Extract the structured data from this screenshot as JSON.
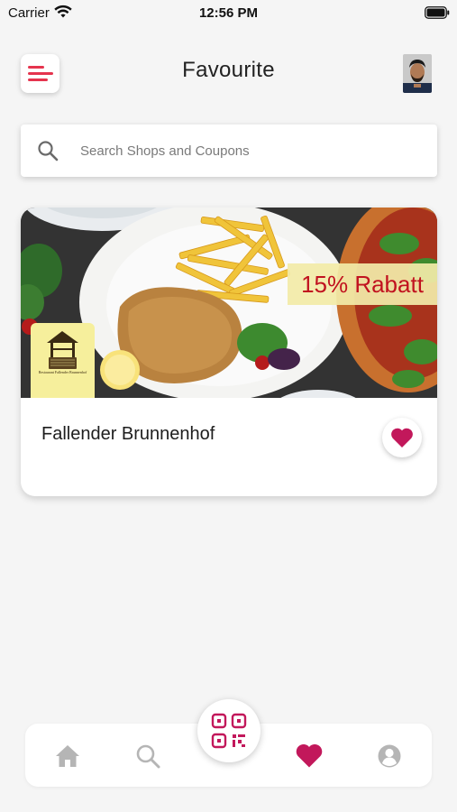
{
  "status_bar": {
    "carrier": "Carrier",
    "time": "12:56 PM"
  },
  "header": {
    "title": "Favourite",
    "menu_icon": "hamburger-menu-icon",
    "avatar": "user-avatar"
  },
  "search": {
    "placeholder": "Search Shops and Coupons",
    "value": ""
  },
  "favourites": [
    {
      "name": "Fallender Brunnenhof",
      "discount": "15% Rabatt",
      "logo_text": "Restaurant Fallender Brunnenhof",
      "is_favorite": true
    }
  ],
  "bottom_nav": {
    "items": [
      "home-icon",
      "search-icon",
      "qr-code-icon",
      "heart-icon",
      "profile-icon"
    ],
    "active": "heart-icon"
  },
  "colors": {
    "accent": "#c2185b",
    "menu_accent": "#e5344e",
    "discount_text": "#c1121f",
    "discount_bg": "#f2eba8",
    "inactive_icon": "#b5b5b5",
    "background": "#f5f5f5"
  }
}
